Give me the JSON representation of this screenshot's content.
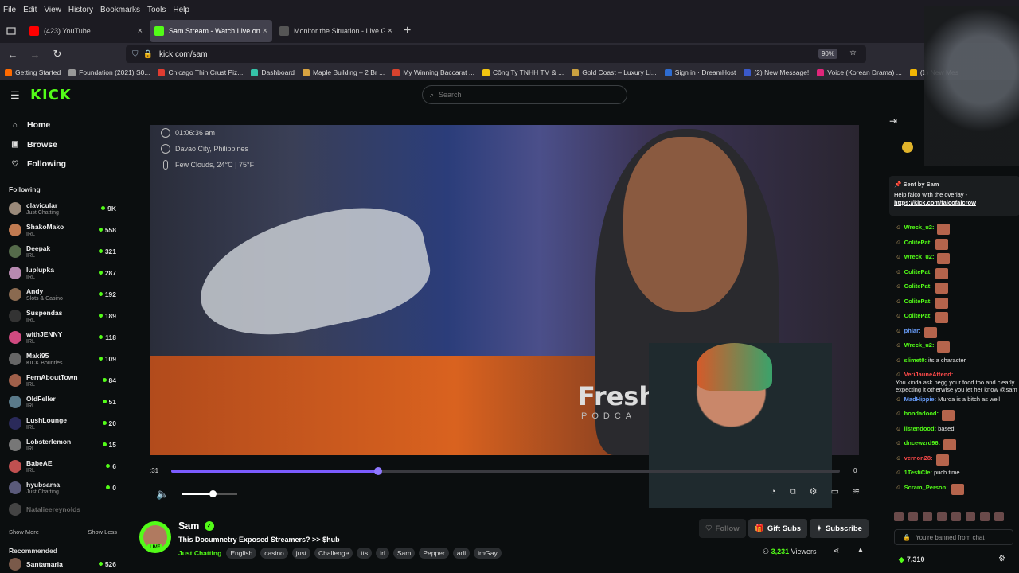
{
  "menu": [
    "File",
    "Edit",
    "View",
    "History",
    "Bookmarks",
    "Tools",
    "Help"
  ],
  "tabs": [
    {
      "title": "(423) YouTube",
      "color": "#ff0000",
      "active": false
    },
    {
      "title": "Sam Stream - Watch Live on Kick",
      "color": "#53fc18",
      "active": true
    },
    {
      "title": "Monitor the Situation - Live Glo",
      "color": "#555555",
      "active": false
    }
  ],
  "url": "kick.com/sam",
  "zoom": "90%",
  "bookmarks": [
    {
      "label": "Getting Started",
      "color": "#ff6a00"
    },
    {
      "label": "Foundation (2021) S0...",
      "color": "#999999"
    },
    {
      "label": "Chicago Thin Crust Piz...",
      "color": "#e03c31"
    },
    {
      "label": "Dashboard",
      "color": "#35c2a8"
    },
    {
      "label": "Maple Building – 2 Br ...",
      "color": "#d9a441"
    },
    {
      "label": "My Winning Baccarat ...",
      "color": "#d8432e"
    },
    {
      "label": "Công Ty TNHH TM & ...",
      "color": "#f2c511"
    },
    {
      "label": "Gold Coast – Luxury Li...",
      "color": "#c9a040"
    },
    {
      "label": "Sign in · DreamHost",
      "color": "#2e6cd1"
    },
    {
      "label": "(2) New Message!",
      "color": "#3a59c9"
    },
    {
      "label": "Voice (Korean Drama) ...",
      "color": "#e0267a"
    },
    {
      "label": "(1) New Mes",
      "color": "#f2b705"
    }
  ],
  "kick": {
    "logo": "KICK",
    "search_placeholder": "Search"
  },
  "sidebar": {
    "nav": [
      {
        "label": "Home",
        "icon": "home-icon",
        "glyph": "⌂"
      },
      {
        "label": "Browse",
        "icon": "browse-icon",
        "glyph": "▣"
      },
      {
        "label": "Following",
        "icon": "heart-icon",
        "glyph": "♡"
      }
    ],
    "following_title": "Following",
    "channels": [
      {
        "name": "clavicular",
        "category": "Just Chatting",
        "viewers": "9K",
        "color": "#9a8a7a"
      },
      {
        "name": "ShakoMako",
        "category": "IRL",
        "viewers": "558",
        "color": "#c07a50"
      },
      {
        "name": "Deepak",
        "category": "IRL",
        "viewers": "321",
        "color": "#556b4a"
      },
      {
        "name": "luplupka",
        "category": "IRL",
        "viewers": "287",
        "color": "#b78ab0"
      },
      {
        "name": "Andy",
        "category": "Slots & Casino",
        "viewers": "192",
        "color": "#8a6a50"
      },
      {
        "name": "Suspendas",
        "category": "IRL",
        "viewers": "189",
        "color": "#333333"
      },
      {
        "name": "withJENNY",
        "category": "IRL",
        "viewers": "118",
        "color": "#d04a80"
      },
      {
        "name": "Maki95",
        "category": "KICK Bounties",
        "viewers": "109",
        "color": "#666666"
      },
      {
        "name": "FernAboutTown",
        "category": "IRL",
        "viewers": "84",
        "color": "#a0604a"
      },
      {
        "name": "OldFeller",
        "category": "IRL",
        "viewers": "51",
        "color": "#5a7a8a"
      },
      {
        "name": "LushLounge",
        "category": "IRL",
        "viewers": "20",
        "color": "#2a2a5a"
      },
      {
        "name": "Lobsterlemon",
        "category": "IRL",
        "viewers": "15",
        "color": "#777777"
      },
      {
        "name": "BabeAE",
        "category": "IRL",
        "viewers": "6",
        "color": "#c05050"
      },
      {
        "name": "hyubsama",
        "category": "Just Chatting",
        "viewers": "0",
        "color": "#5a5a7a"
      }
    ],
    "dim_channel": "Natalieereynolds",
    "show_more": "Show More",
    "show_less": "Show Less",
    "recommended_title": "Recommended",
    "recommended_first": {
      "name": "Santamaria",
      "viewers": "526"
    }
  },
  "player": {
    "overlay_time": "01:06:36 am",
    "overlay_location": "Davao City, Philippines",
    "overlay_weather": "Few Clouds, 24°C | 75°F",
    "hoodie_text": "Fresh&F",
    "hoodie_sub": "PODCA",
    "time_left": ":31",
    "time_right": "0",
    "progress": 0.31,
    "volume": 0.55
  },
  "channel": {
    "name": "Sam",
    "live_label": "LIVE",
    "title": "This Documnetry Exposed Streamers? >> $hub",
    "category": "Just Chatting",
    "tags": [
      "English",
      "casino",
      "just",
      "Challenge",
      "tts",
      "irl",
      "Sam",
      "Pepper",
      "adi",
      "imGay"
    ],
    "follow": "Follow",
    "gift_subs": "Gift Subs",
    "subscribe": "Subscribe",
    "viewers": "3,231",
    "viewers_label": "Viewers"
  },
  "chat": {
    "pinned_sent_by": "Sent by",
    "pinned_user": "Sam",
    "pinned_message": "Help falco with the overlay - ",
    "pinned_link": "https://kick.com/falcofalcrow",
    "messages": [
      {
        "user": "Wreck_u2:",
        "color": "#53fc18",
        "text": "",
        "emote": true
      },
      {
        "user": "ColitePat:",
        "color": "#53fc18",
        "text": "",
        "emote": true
      },
      {
        "user": "Wreck_u2:",
        "color": "#53fc18",
        "text": "",
        "emote": true
      },
      {
        "user": "ColitePat:",
        "color": "#53fc18",
        "text": "",
        "emote": true
      },
      {
        "user": "ColitePat:",
        "color": "#53fc18",
        "text": "",
        "emote": true
      },
      {
        "user": "ColitePat:",
        "color": "#53fc18",
        "text": "",
        "emote": true
      },
      {
        "user": "ColitePat:",
        "color": "#53fc18",
        "text": "",
        "emote": true
      },
      {
        "user": "phiar:",
        "color": "#6aa0ff",
        "text": "",
        "emote": true
      },
      {
        "user": "Wreck_u2:",
        "color": "#53fc18",
        "text": "",
        "emote": true
      },
      {
        "user": "slimet0:",
        "color": "#53fc18",
        "text": "its a character",
        "emote": false
      },
      {
        "user": "VeriJauneAttend:",
        "color": "#ff4a4a",
        "text": "You kinda ask pegg your food too and clearly expecting it otherwise you let her know @sam",
        "emote": false
      },
      {
        "user": "MadHippie:",
        "color": "#6aa0ff",
        "text": "Murda is a bitch as well",
        "emote": false
      },
      {
        "user": "hondadood:",
        "color": "#53fc18",
        "text": "",
        "emote": true
      },
      {
        "user": "listendood:",
        "color": "#53fc18",
        "text": "based",
        "emote": false
      },
      {
        "user": "dncewzrd96:",
        "color": "#53fc18",
        "text": "",
        "emote": true
      },
      {
        "user": "vernon28:",
        "color": "#ff4a4a",
        "text": "",
        "emote": true
      },
      {
        "user": "1TestiCle:",
        "color": "#53fc18",
        "text": "puch time",
        "emote": false
      },
      {
        "user": "Scram_Person:",
        "color": "#53fc18",
        "text": "",
        "emote": true
      }
    ],
    "banned_text": "You're banned from chat",
    "points": "7,310"
  }
}
